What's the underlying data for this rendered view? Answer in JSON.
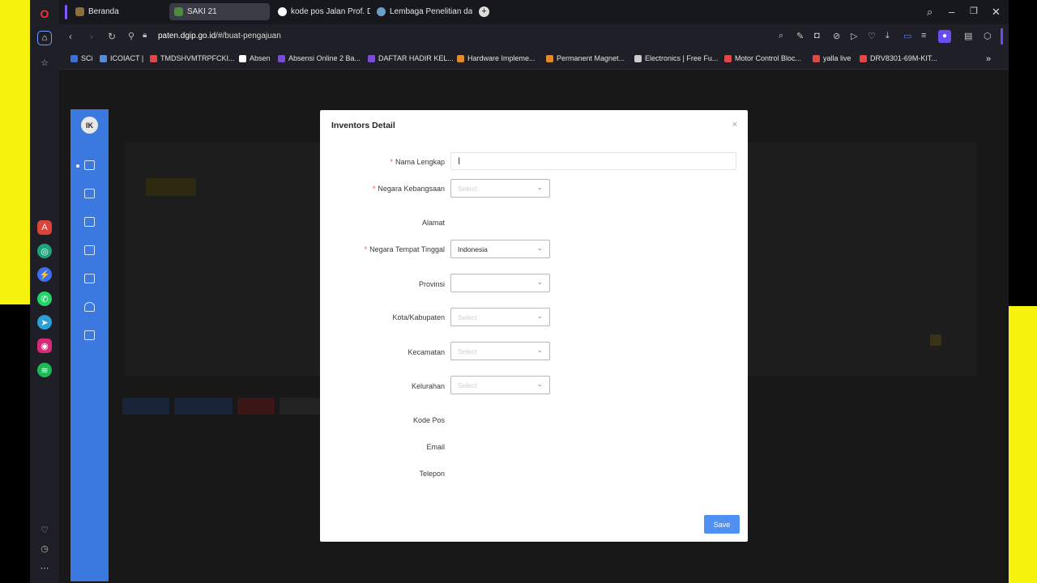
{
  "browser": {
    "tabs": [
      {
        "label": "Beranda",
        "color": "#8c6e3a"
      },
      {
        "label": "SAKI 21",
        "color": "#4a8c3a"
      },
      {
        "label": "kode pos Jalan Prof. Dr. H",
        "color": "#ffffff"
      },
      {
        "label": "Lembaga Penelitian dan P",
        "color": "#6aa0c8"
      }
    ],
    "url_host": "paten.dgip.go.id",
    "url_path": "/#/buat-pengajuan",
    "bookmarks": [
      {
        "label": "SCi",
        "color": "#3a6fd8"
      },
      {
        "label": "ICOIACT |",
        "color": "#5b8ad6"
      },
      {
        "label": "TMDSHVMTRPFCKI...",
        "color": "#e04848"
      },
      {
        "label": "Absen",
        "color": "#ffffff"
      },
      {
        "label": "Absensi Online 2 Ba...",
        "color": "#7a4bd6"
      },
      {
        "label": "DAFTAR HADIR KEL...",
        "color": "#7a4bd6"
      },
      {
        "label": "Hardware Impleme...",
        "color": "#e08a2a"
      },
      {
        "label": "Permanent Magnet...",
        "color": "#e08a2a"
      },
      {
        "label": "Electronics | Free Fu...",
        "color": "#cccccc"
      },
      {
        "label": "Motor Control Bloc...",
        "color": "#e04848"
      },
      {
        "label": "yalla live",
        "color": "#e04848"
      },
      {
        "label": "DRV8301-69M-KIT...",
        "color": "#e04848"
      }
    ]
  },
  "modal": {
    "title": "Inventors Detail",
    "close": "×",
    "fields": {
      "nama_lengkap": "Nama Lengkap",
      "negara_kebangsaan": "Negara Kebangsaan",
      "alamat": "Alamat",
      "negara_tempat_tinggal": "Negara Tempat Tinggal",
      "provinsi": "Provinsi",
      "kota": "Kota/Kabupaten",
      "kecamatan": "Kecamatan",
      "kelurahan": "Kelurahan",
      "kode_pos": "Kode Pos",
      "email": "Email",
      "telepon": "Telepon"
    },
    "required_mark": "*",
    "select_placeholder": "Select",
    "negara_tempat_tinggal_value": "Indonesia",
    "save_label": "Save"
  },
  "icons": {
    "chevron": "⌄"
  },
  "colors": {
    "accent": "#4f90f2",
    "sidebar": "#3b79e0",
    "highlight": "#f7f30f"
  }
}
